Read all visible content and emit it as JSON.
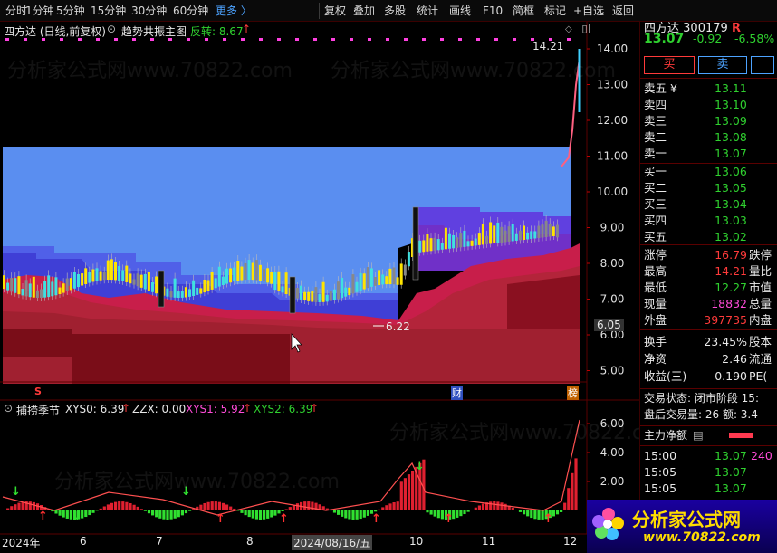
{
  "toolbar": {
    "items": [
      "分时",
      "1分钟",
      "5分钟",
      "15分钟",
      "30分钟",
      "60分钟",
      "更多 〉"
    ],
    "right": [
      "复权",
      "叠加",
      "多股",
      "统计",
      "画线",
      "F10",
      "简框",
      "标记",
      "+自选",
      "返回"
    ]
  },
  "main_chart": {
    "stock_label": "四方达 (日线,前复权)",
    "indicator": "趋势共振主图",
    "signal_label": "反转: 8.67",
    "signal_arrow": "↑",
    "high_label": "14.21",
    "low_label": "6.22",
    "price_marker": "6.05",
    "y_ticks": [
      "14.00",
      "13.00",
      "12.00",
      "11.00",
      "10.00",
      "9.00",
      "8.00",
      "7.00",
      "6.00",
      "5.00"
    ],
    "mark_s": "S",
    "mark_cai": "财",
    "mark_bang": "榜"
  },
  "sub_chart": {
    "name": "捕捞季节",
    "xys0": "XYS0: 6.39",
    "zzx": "ZZX: 0.00",
    "xys1": "XYS1: 5.92",
    "xys2": "XYS2: 6.39",
    "arrow": "↑",
    "y_ticks": [
      "6.00",
      "4.00",
      "2.00"
    ]
  },
  "x_axis": [
    "2024年",
    "6",
    "7",
    "8",
    "2024/08/16/五",
    "10",
    "11",
    "12"
  ],
  "watermarks": [
    "分析家公式网www.70822.com",
    "分析家公式网www.70822.com"
  ],
  "quote": {
    "name": "四方达",
    "code": "300179",
    "flag": "R",
    "price": "13.07",
    "change": "-0.92",
    "pct": "-6.58%",
    "buy_btn": "买",
    "sell_btn": "卖",
    "sell_levels": [
      {
        "label": "卖五 ¥",
        "price": "13.11"
      },
      {
        "label": "卖四",
        "price": "13.10"
      },
      {
        "label": "卖三",
        "price": "13.09"
      },
      {
        "label": "卖二",
        "price": "13.08"
      },
      {
        "label": "卖一",
        "price": "13.07"
      }
    ],
    "buy_levels": [
      {
        "label": "买一",
        "price": "13.06"
      },
      {
        "label": "买二",
        "price": "13.05"
      },
      {
        "label": "买三",
        "price": "13.04"
      },
      {
        "label": "买四",
        "price": "13.03"
      },
      {
        "label": "买五",
        "price": "13.02"
      }
    ],
    "stats": [
      {
        "label": "涨停",
        "value": "16.79",
        "extra": "跌停"
      },
      {
        "label": "最高",
        "value": "14.21",
        "extra": "量比"
      },
      {
        "label": "最低",
        "value": "12.27",
        "extra": "市值"
      },
      {
        "label": "现量",
        "value": "18832",
        "extra": "总量"
      },
      {
        "label": "外盘",
        "value": "397735",
        "extra": "内盘"
      }
    ],
    "stats2": [
      {
        "label": "换手",
        "value": "23.45%",
        "extra": "股本"
      },
      {
        "label": "净资",
        "value": "2.46",
        "extra": "流通"
      },
      {
        "label": "收益(三)",
        "value": "0.190",
        "extra": "PE("
      }
    ],
    "trade_status": "交易状态: 闭市阶段 15:",
    "after_hours": "盘后交易量: 26  额: 3.4",
    "main_net": "主力净额",
    "ticks": [
      {
        "time": "15:00",
        "price": "13.07",
        "vol": "240"
      },
      {
        "time": "15:05",
        "price": "13.07",
        "vol": ""
      },
      {
        "time": "15:05",
        "price": "13.07",
        "vol": ""
      }
    ]
  },
  "logo": {
    "title": "分析家公式网",
    "url": "www.70822.com"
  }
}
